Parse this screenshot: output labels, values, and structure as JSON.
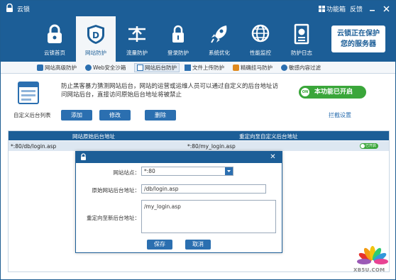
{
  "app": {
    "title": "云锁",
    "menu_label": "功能箱",
    "feedback_label": "反馈"
  },
  "nav": {
    "items": [
      {
        "label": "云锁首页",
        "icon": "padlock-cloud-icon"
      },
      {
        "label": "网站防护",
        "icon": "shield-d-icon"
      },
      {
        "label": "流量防护",
        "icon": "traffic-icon"
      },
      {
        "label": "登录防护",
        "icon": "lock-icon"
      },
      {
        "label": "系统优化",
        "icon": "rocket-icon"
      },
      {
        "label": "性能监控",
        "icon": "monitor-globe-icon"
      },
      {
        "label": "防护日志",
        "icon": "log-document-icon"
      }
    ],
    "active_index": 1,
    "promo_line1": "云锁正在保护",
    "promo_line2": "您的服务器"
  },
  "subtabs": [
    {
      "label": "网站高级防护"
    },
    {
      "label": "Web安全沙箱"
    },
    {
      "label": "网站后台防护"
    },
    {
      "label": "文件上传防护"
    },
    {
      "label": "精确挂马防护"
    },
    {
      "label": "敏感内容过滤"
    }
  ],
  "subtab_active_index": 2,
  "info": {
    "description": "防止黑客暴力猜测网站后台，网站的运营或运维人员可以通过自定义的后台地址访问网站后台，直接访问原始后台地址将被禁止",
    "icon_caption": "自定义后台列表",
    "add_label": "添加",
    "edit_label": "修改",
    "delete_label": "删除",
    "toggle_label": "本功能已开启",
    "toggle_knob": "ON",
    "intercept_label": "拦截设置"
  },
  "table": {
    "col1": "网站原始后台地址",
    "col2": "重定向至自定义后台地址",
    "rows": [
      {
        "original": "*:80/db/login.asp",
        "redirect": "*:80/my_login.asp",
        "status": "已开启"
      }
    ]
  },
  "dialog": {
    "close_glyph": "✕",
    "site_label": "网站站点：",
    "site_value": "*:80",
    "orig_label": "原始网站后台地址：",
    "orig_value": "/db/login.asp",
    "redir_label": "重定向至新后台地址：",
    "redir_value": "/my_login.asp",
    "save_label": "保存",
    "cancel_label": "取消"
  },
  "watermark": "XB5U.COM",
  "colors": {
    "brand_blue": "#1c5e97",
    "button_blue": "#2b6fb0",
    "toggle_green": "#3aa63a"
  }
}
